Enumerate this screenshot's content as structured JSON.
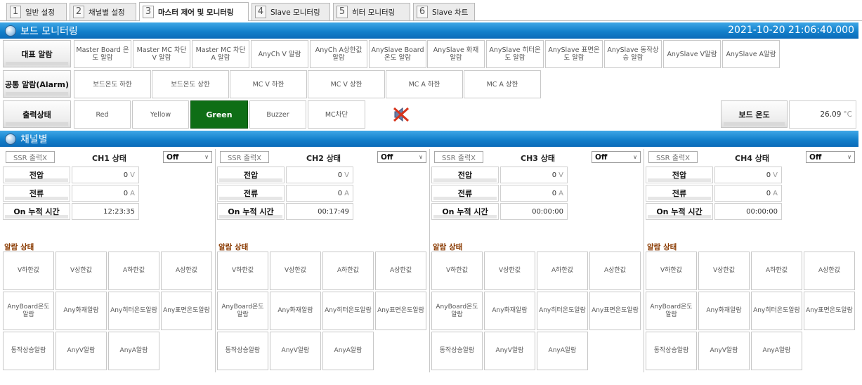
{
  "tabs": [
    {
      "num": "1",
      "label": "일반 설정"
    },
    {
      "num": "2",
      "label": "채널별 설정"
    },
    {
      "num": "3",
      "label": "마스터 제어 및 모니터링"
    },
    {
      "num": "4",
      "label": "Slave 모니터링"
    },
    {
      "num": "5",
      "label": "히터 모니터링"
    },
    {
      "num": "6",
      "label": "Slave 차트"
    }
  ],
  "board_section": {
    "title": "보드 모니터링",
    "datetime": "2021-10-20 21:06:40.000"
  },
  "rep_alarm": {
    "label": "대표 알람",
    "items": [
      "Master Board 온도 알람",
      "Master MC 차단 V 알람",
      "Master MC 차단 A 알람",
      "AnyCh V 알람",
      "AnyCh A상한값 알람",
      "AnySlave Board 온도 알람",
      "AnySlave 화재 알람",
      "AnySlave 히터온도 알람",
      "AnySlave 표면온도 알람",
      "AnySlave 동작상승 알람",
      "AnySlave V알람",
      "AnySlave A알람"
    ]
  },
  "common_alarm": {
    "label": "공통 알람(Alarm)",
    "items": [
      "보드온도 하한",
      "보드온도 상한",
      "MC V 하한",
      "MC V 상한",
      "MC A 하한",
      "MC A 상한"
    ]
  },
  "output_state": {
    "label": "출력상태",
    "items": [
      "Red",
      "Yellow",
      "Green",
      "Buzzer",
      "MC차단"
    ],
    "active": "Green",
    "active_color": "#0f6e16",
    "buzzer_icon": "speaker-muted-icon"
  },
  "board_temp": {
    "label": "보드 온도",
    "value": "26.09",
    "unit": "°C"
  },
  "channel_section": {
    "title": "채널별"
  },
  "channel_common": {
    "ssr_label": "SSR 출력X",
    "voltage_label": "전압",
    "current_label": "전류",
    "on_time_label": "On 누적 시간",
    "voltage_unit": "V",
    "current_unit": "A",
    "alarm_title": "알람 상태",
    "alarms": [
      "V하한값",
      "V상한값",
      "A하한값",
      "A상한값",
      "AnyBoard온도 알람",
      "Any화재알람",
      "Any히터온도알람",
      "Any표면온도알람",
      "동작상승알람",
      "AnyV알람",
      "AnyA알람"
    ]
  },
  "channels": [
    {
      "title": "CH1 상태",
      "state": "Off",
      "voltage": "0",
      "current": "0",
      "on_time": "12:23:35"
    },
    {
      "title": "CH2 상태",
      "state": "Off",
      "voltage": "0",
      "current": "0",
      "on_time": "00:17:49"
    },
    {
      "title": "CH3 상태",
      "state": "Off",
      "voltage": "0",
      "current": "0",
      "on_time": "00:00:00"
    },
    {
      "title": "CH4 상태",
      "state": "Off",
      "voltage": "0",
      "current": "0",
      "on_time": "00:00:00"
    }
  ]
}
